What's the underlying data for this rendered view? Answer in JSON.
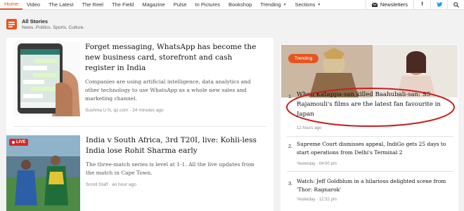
{
  "nav": {
    "items": [
      "Home",
      "Video",
      "The Latest",
      "The Reel",
      "The Field",
      "Magazine",
      "Pulse",
      "In Pictures",
      "Bookshop"
    ],
    "trending": "Trending",
    "sections": "Sections",
    "newsletters": "Newsletters",
    "accent": "#e8541e"
  },
  "header": {
    "title": "All Stories",
    "subtitle": "News. Politics. Sports. Culture."
  },
  "stories": [
    {
      "headline": "Forget messaging, WhatsApp has become the new business card, storefront and cash register in India",
      "summary": "Companies are using artificial intelligence, data analytics and other technology to use WhatsApp as a whole new sales and marketing channel.",
      "author": "Sushma U N, qz.com",
      "time": "24 minutes ago"
    },
    {
      "headline": "India v South Africa, 3rd T20I, live: Kohli-less India lose Rohit Sharma early",
      "summary": "The three-match series is level at 1-1. All the live updates from the match in Cape Town.",
      "author": "Scroll Staff",
      "time": "an hour ago",
      "badge": "LIVE"
    }
  ],
  "trending": {
    "badge": "Trending",
    "items": [
      {
        "num": "1.",
        "title": "When Katappa-san killed Baahubali-san: SS Rajamouli's films are the latest fan favourite in Japan",
        "meta": "12 hours ago"
      },
      {
        "num": "2.",
        "title": "Supreme Court dismisses appeal, IndiGo gets 25 days to start operations from Delhi's Terminal 2",
        "meta": "Yesterday · 04:00 pm"
      },
      {
        "num": "3.",
        "title": "Watch: Jeff Goldblum in a hilarious delighted scene from 'Thor: Ragnarok'",
        "meta": "Yesterday · 12:32 pm"
      }
    ]
  }
}
